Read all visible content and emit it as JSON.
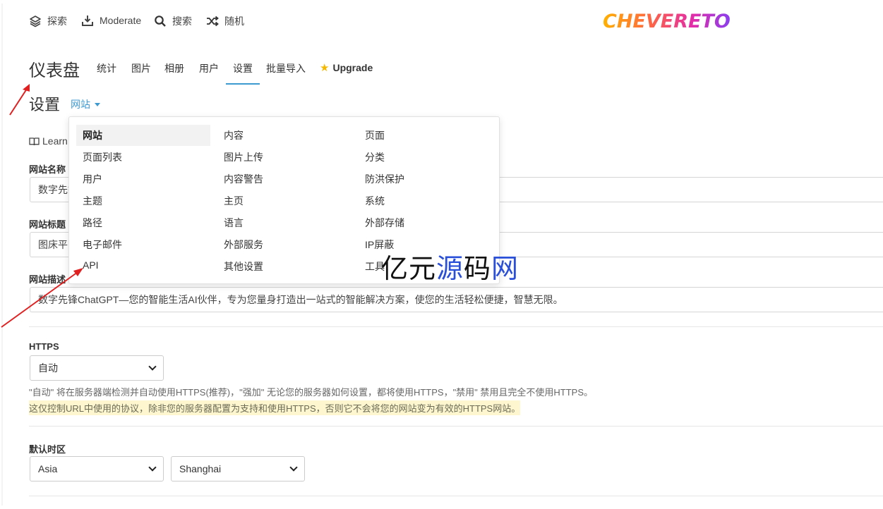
{
  "topnav": {
    "items": [
      {
        "label": "探索",
        "icon": "layers-icon"
      },
      {
        "label": "Moderate",
        "icon": "inbox-tray-icon"
      },
      {
        "label": "搜索",
        "icon": "search-icon"
      },
      {
        "label": "随机",
        "icon": "shuffle-icon"
      }
    ],
    "logo": "CHEVERETO"
  },
  "dashboard": {
    "title": "仪表盘",
    "tabs": [
      "统计",
      "图片",
      "相册",
      "用户",
      "设置",
      "批量导入"
    ],
    "active_tab": "设置",
    "upgrade": "Upgrade"
  },
  "settings": {
    "title": "设置",
    "section_dropdown": "网站",
    "learn": "Learn"
  },
  "dropdown": {
    "columns": [
      [
        "网站",
        "页面列表",
        "用户",
        "主题",
        "路径",
        "电子邮件",
        "API"
      ],
      [
        "内容",
        "图片上传",
        "内容警告",
        "主页",
        "语言",
        "外部服务",
        "其他设置"
      ],
      [
        "页面",
        "分类",
        "防洪保护",
        "系统",
        "外部存储",
        "IP屏蔽",
        "工具"
      ]
    ],
    "selected": "网站"
  },
  "form": {
    "site_name": {
      "label": "网站名称",
      "value": "数字先锋"
    },
    "site_title": {
      "label": "网站标题",
      "value": "图床平"
    },
    "site_description": {
      "label": "网站描述",
      "value": "数字先锋ChatGPT—您的智能生活AI伙伴，专为您量身打造出一站式的智能解决方案，使您的生活轻松便捷，智慧无限。"
    },
    "https": {
      "label": "HTTPS",
      "value": "自动",
      "help": "\"自动\" 将在服务器端检测并自动使用HTTPS(推荐)，\"强加\" 无论您的服务器如何设置，都将使用HTTPS，\"禁用\" 禁用且完全不使用HTTPS。",
      "warning": "这仅控制URL中使用的协议，除非您的服务器配置为支持和使用HTTPS，否则它不会将您的网站变为有效的HTTPS网站。"
    },
    "timezone": {
      "label": "默认时区",
      "region": "Asia",
      "city": "Shanghai"
    }
  },
  "watermark": {
    "prefix": "亿元",
    "accent_char": "源",
    "middle": "码",
    "suffix": "网"
  },
  "colors": {
    "accent": "#3d9ad1",
    "arrow": "#e02020",
    "star": "#f5b800",
    "warning_bg": "#fdf6cf"
  }
}
